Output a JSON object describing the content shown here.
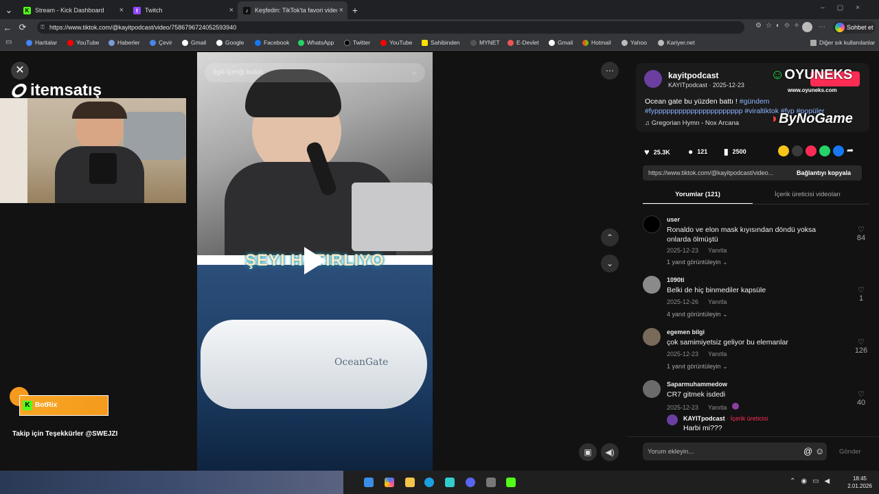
{
  "browser": {
    "tabs": [
      {
        "label": "Stream - Kick Dashboard",
        "fav": "K",
        "color": "#53fc18"
      },
      {
        "label": "Twitch",
        "fav": "t",
        "color": "#9146ff"
      },
      {
        "label": "Keşfedin: TikTok'ta favori videoları…",
        "fav": "♪",
        "color": "#111111"
      }
    ],
    "url": "https://www.tiktok.com/@kayitpodcast/video/7586796724052593940",
    "chat_label": "Sohbet et",
    "bookmarks": [
      "Haritalar",
      "YouTube",
      "Haberler",
      "Çevir",
      "Gmail",
      "Google",
      "Facebook",
      "WhatsApp",
      "Twitter",
      "YouTube",
      "Sahibinden",
      "MYNET",
      "E-Devlet",
      "Gmail",
      "Hotmail",
      "Yahoo",
      "Kariyer.net"
    ],
    "other_bookmarks": "Diğer sık kullanılanlar"
  },
  "overlay": {
    "sponsor": "itemsatış",
    "botrix": "BotRix",
    "follow_thanks": "Takip için Teşekkürler @SWEJZI",
    "oyuneks": "OYUNEKS",
    "oyuneks_url": "www.oyuneks.com",
    "bynogame": "ByNoGame"
  },
  "video": {
    "search_placeholder": "İlgili içeriği bulun",
    "caption": "ŞEYI HATIRLIYO",
    "sub_brand": "OceanGate"
  },
  "post": {
    "username": "kayitpodcast",
    "handle_date": "KAYITpodcast · 2025-12-23",
    "description": "Ocean gate bu yüzden battı ! ",
    "hashtags": "#gündem #fypppppppppppppppppppppp #viraltiktok #fyp #popüler",
    "music": "Gregorian Hymn - Nox Arcana",
    "likes": "25.3K",
    "comments_count": "121",
    "saves": "2500",
    "link_short": "https://www.tiktok.com/@kayitpodcast/video...",
    "copy_link": "Bağlantıyı kopyala",
    "tab_comments": "Yorumlar (121)",
    "tab_creator": "İçerik üreticisi videoları"
  },
  "comments": [
    {
      "user": "user",
      "text": "Ronaldo ve elon mask kıyısından döndü yoksa onlarda ölmüştü",
      "date": "2025-12-23",
      "reply": "Yanıtla",
      "likes": "84",
      "more": "1 yanıt görüntüleyin",
      "avatar": "#000000"
    },
    {
      "user": "1090ti",
      "text": "Belki de hiç binmediler kapsüle",
      "date": "2025-12-26",
      "reply": "Yanıtla",
      "likes": "1",
      "more": "4 yanıt görüntüleyin",
      "avatar": "#9a9a9a"
    },
    {
      "user": "egemen bilgi",
      "text": "çok samimiyetsiz geliyor bu elemanlar",
      "date": "2025-12-23",
      "reply": "Yanıtla",
      "likes": "126",
      "more": "1 yanıt görüntüleyin",
      "avatar": "#7a6a5a"
    },
    {
      "user": "Saparmuhammedow",
      "text": "CR7 gitmek isdedi",
      "date": "2025-12-23",
      "reply": "Yanıtla",
      "likes": "40",
      "more": "",
      "avatar": "#6b6b6b"
    }
  ],
  "reply": {
    "user": "KAYITpodcast",
    "badge": "İçerik üreticisi",
    "text": "Harbi mi???"
  },
  "composer": {
    "placeholder": "Yorum ekleyin...",
    "send": "Gönder"
  },
  "clock": {
    "time": "18:45",
    "date": "2.01.2026"
  }
}
